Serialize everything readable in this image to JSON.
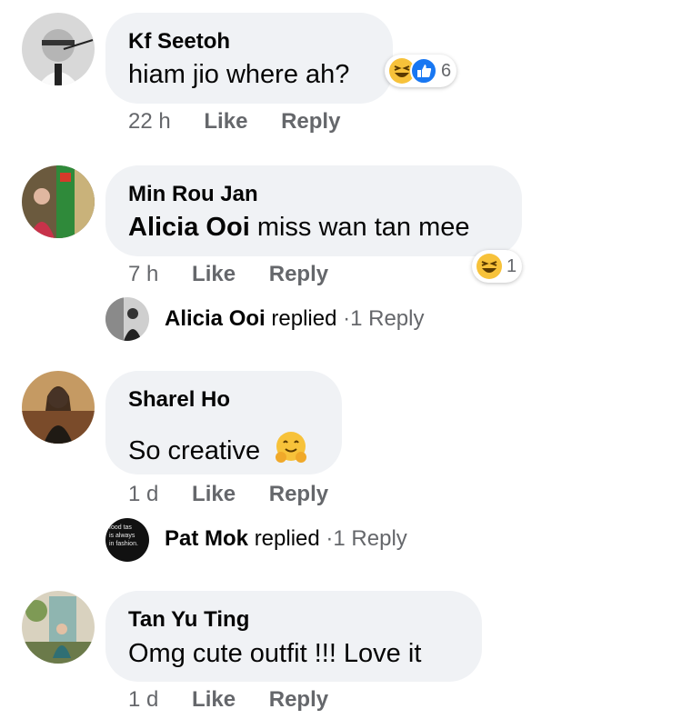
{
  "comments": [
    {
      "author": "Kf Seetoh",
      "text": "hiam jio where ah?",
      "time": "22 h",
      "like_label": "Like",
      "reply_label": "Reply",
      "reactions": {
        "icons": [
          "haha-emoji-icon",
          "like-thumb-icon"
        ],
        "count": "6"
      }
    },
    {
      "author": "Min Rou Jan",
      "mention": "Alicia Ooi",
      "text": "miss wan tan mee",
      "time": "7 h",
      "like_label": "Like",
      "reply_label": "Reply",
      "reactions": {
        "icons": [
          "haha-emoji-icon"
        ],
        "count": "1"
      },
      "replies": {
        "name": "Alicia Ooi",
        "verb": "replied",
        "sep": "·",
        "count_label": "1 Reply"
      }
    },
    {
      "author": "Sharel Ho",
      "text": "So creative",
      "emoji": "hugging-face-icon",
      "time": "1 d",
      "like_label": "Like",
      "reply_label": "Reply",
      "replies": {
        "name": "Pat Mok",
        "verb": "replied",
        "sep": "·",
        "count_label": "1 Reply"
      }
    },
    {
      "author": "Tan Yu Ting",
      "text": "Omg cute outfit !!! Love it",
      "time": "1 d",
      "like_label": "Like",
      "reply_label": "Reply"
    }
  ],
  "avatar_sign_text": "food tas is always in fashion.",
  "colors": {
    "bubble": "#f0f2f5",
    "secondary_text": "#65676b",
    "like_blue": "#1877f2",
    "emoji_yellow": "#f7c23a"
  }
}
